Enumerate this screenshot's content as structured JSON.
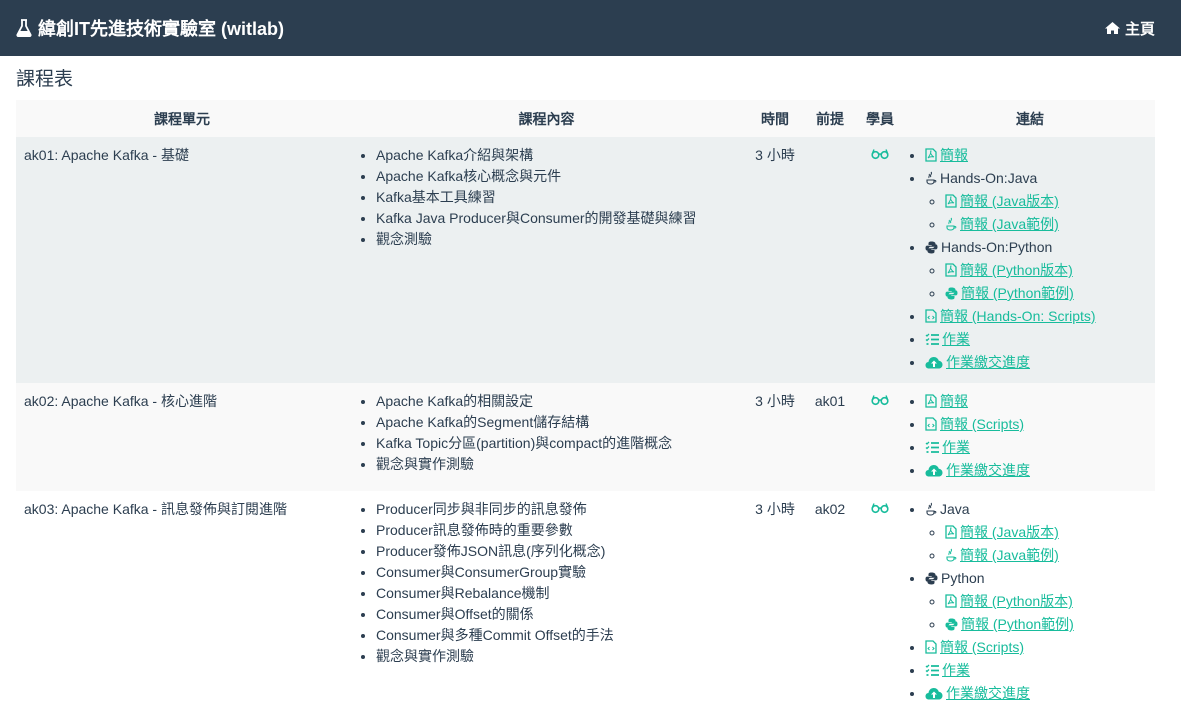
{
  "nav": {
    "brand": "緯創IT先進技術實驗室 (witlab)",
    "home": "主頁"
  },
  "page_title": "課程表",
  "headers": {
    "unit": "課程單元",
    "content": "課程內容",
    "time": "時間",
    "prereq": "前提",
    "student": "學員",
    "links": "連結"
  },
  "colors": {
    "navbar": "#2c3e50",
    "accent": "#18bc9c",
    "text": "#2c3e50"
  },
  "rows": [
    {
      "unit": "ak01: Apache Kafka - 基礎",
      "content": [
        "Apache Kafka介紹與架構",
        "Apache Kafka核心概念與元件",
        "Kafka基本工具練習",
        "Kafka Java Producer與Consumer的開發基礎與練習",
        "觀念測驗"
      ],
      "time": "3 小時",
      "prereq": "",
      "links": [
        {
          "icon": "pdf-icon",
          "text": "簡報",
          "link": true
        },
        {
          "icon": "java-icon",
          "text": "Hands-On:Java",
          "link": false,
          "sub": [
            {
              "icon": "pdf-icon",
              "text": "簡報 (Java版本)"
            },
            {
              "icon": "java-icon",
              "text": "簡報 (Java範例)"
            }
          ]
        },
        {
          "icon": "python-icon",
          "text": "Hands-On:Python",
          "link": false,
          "sub": [
            {
              "icon": "pdf-icon",
              "text": "簡報 (Python版本)"
            },
            {
              "icon": "python-icon",
              "text": "簡報 (Python範例)"
            }
          ]
        },
        {
          "icon": "code-file-icon",
          "text": "簡報 (Hands-On: Scripts)",
          "link": true
        },
        {
          "icon": "tasks-icon",
          "text": "作業",
          "link": true
        },
        {
          "icon": "cloud-upload-icon",
          "text": "作業繳交進度",
          "link": true
        }
      ]
    },
    {
      "unit": "ak02: Apache Kafka - 核心進階",
      "content": [
        "Apache Kafka的相關設定",
        "Apache Kafka的Segment儲存結構",
        "Kafka Topic分區(partition)與compact的進階概念",
        "觀念與實作測驗"
      ],
      "time": "3 小時",
      "prereq": "ak01",
      "links": [
        {
          "icon": "pdf-icon",
          "text": "簡報",
          "link": true
        },
        {
          "icon": "code-file-icon",
          "text": "簡報 (Scripts)",
          "link": true
        },
        {
          "icon": "tasks-icon",
          "text": "作業",
          "link": true
        },
        {
          "icon": "cloud-upload-icon",
          "text": "作業繳交進度",
          "link": true
        }
      ]
    },
    {
      "unit": "ak03: Apache Kafka - 訊息發佈與訂閱進階",
      "content": [
        "Producer同步與非同步的訊息發佈",
        "Producer訊息發佈時的重要參數",
        "Producer發佈JSON訊息(序列化概念)",
        "Consumer與ConsumerGroup實驗",
        "Consumer與Rebalance機制",
        "Consumer與Offset的關係",
        "Consumer與多種Commit Offset的手法",
        "觀念與實作測驗"
      ],
      "time": "3 小時",
      "prereq": "ak02",
      "links": [
        {
          "icon": "java-icon",
          "text": "Java",
          "link": false,
          "sub": [
            {
              "icon": "pdf-icon",
              "text": "簡報 (Java版本)"
            },
            {
              "icon": "java-icon",
              "text": "簡報 (Java範例)"
            }
          ]
        },
        {
          "icon": "python-icon",
          "text": "Python",
          "link": false,
          "sub": [
            {
              "icon": "pdf-icon",
              "text": "簡報 (Python版本)"
            },
            {
              "icon": "python-icon",
              "text": "簡報 (Python範例)"
            }
          ]
        },
        {
          "icon": "code-file-icon",
          "text": "簡報 (Scripts)",
          "link": true
        },
        {
          "icon": "tasks-icon",
          "text": "作業",
          "link": true
        },
        {
          "icon": "cloud-upload-icon",
          "text": "作業繳交進度",
          "link": true
        }
      ]
    }
  ]
}
